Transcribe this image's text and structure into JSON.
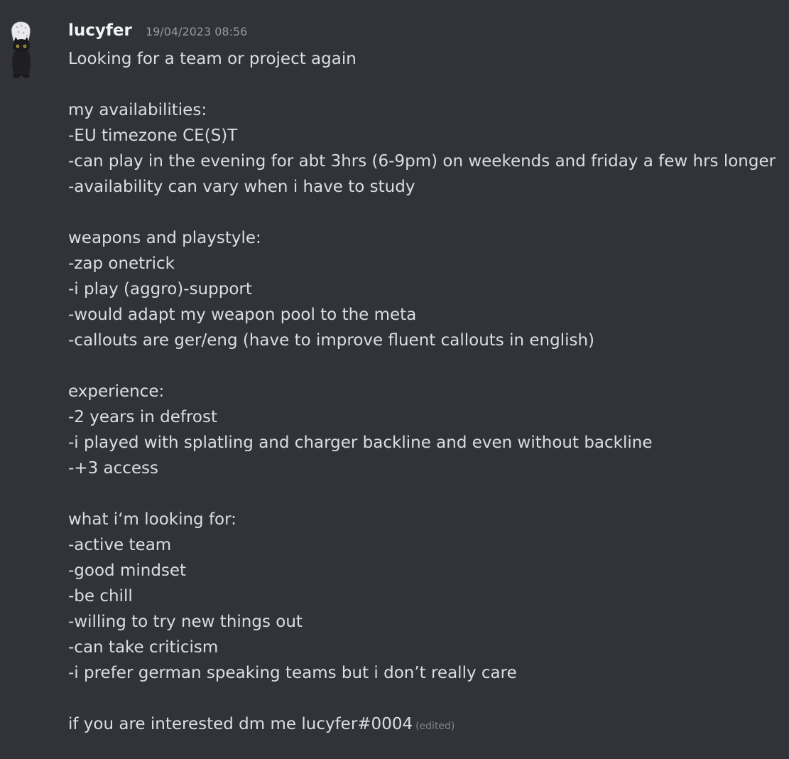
{
  "message": {
    "username": "lucyfer",
    "timestamp": "19/04/2023 08:56",
    "edited_label": "(edited)",
    "lines": [
      "Looking for a team or project again",
      "",
      "my availabilities:",
      "-EU timezone CE(S)T",
      "-can play in the evening for abt 3hrs (6-9pm) on weekends and friday a few hrs longer",
      "-availability can vary when i have to study",
      "",
      "weapons and playstyle:",
      "-zap onetrick",
      "-i play (aggro)-support",
      "-would adapt my weapon pool to the meta",
      "-callouts are ger/eng (have to improve fluent callouts in english)",
      "",
      "experience:",
      "-2 years in defrost",
      "-i played with splatling and charger backline and even without backline",
      "-+3 access",
      "",
      "what i‘m looking for:",
      "-active team",
      "-good mindset",
      "-be chill",
      "-willing to try new things out",
      "-can take criticism",
      "-i prefer german speaking teams but i don’t really care",
      "",
      "if you are interested dm me lucyfer#0004"
    ]
  },
  "colors": {
    "background": "#313338",
    "username": "#f2f3f5",
    "text": "#dbdee1",
    "timestamp": "#949ba4",
    "edited": "#80848e"
  },
  "icons": {
    "avatar": "cat-avatar-icon"
  }
}
